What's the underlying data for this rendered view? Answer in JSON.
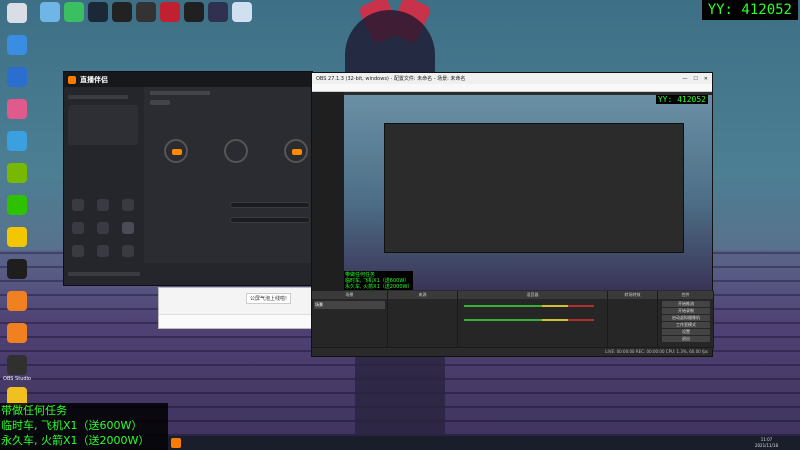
{
  "counter": "YY: 412052",
  "overlay_lines": [
    "带做任何任务",
    "临时车, 飞机X1（送600W）",
    "永久车, 火箭X1（送2000W）"
  ],
  "desktop_left": [
    {
      "label": "",
      "icon": "computer-icon",
      "color": "#d8dde6"
    },
    {
      "label": "",
      "icon": "chat-icon",
      "color": "#3a8de0"
    },
    {
      "label": "",
      "icon": "shield-icon",
      "color": "#2a6fd0"
    },
    {
      "label": "",
      "icon": "petal-icon",
      "color": "#e05a8c"
    },
    {
      "label": "",
      "icon": "cloud-icon",
      "color": "#3aa0e0"
    },
    {
      "label": "",
      "icon": "nvidia-icon",
      "color": "#76b900"
    },
    {
      "label": "",
      "icon": "wechat-icon",
      "color": "#2dc100"
    },
    {
      "label": "",
      "icon": "qq-game-icon",
      "color": "#f2c600"
    },
    {
      "label": "",
      "icon": "qq-icon",
      "color": "#1e1e1e"
    },
    {
      "label": "",
      "icon": "tool-icon",
      "color": "#f08020"
    },
    {
      "label": "",
      "icon": "tool2-icon",
      "color": "#f08020"
    },
    {
      "label": "OBS Studio",
      "icon": "obs-icon",
      "color": "#303030"
    },
    {
      "label": "",
      "icon": "misc-icon",
      "color": "#f0c020"
    }
  ],
  "desktop_top": [
    {
      "label": "",
      "icon": "recycle-icon",
      "color": "#6fb6e6"
    },
    {
      "label": "",
      "icon": "app-icon",
      "color": "#3ac060"
    },
    {
      "label": "",
      "icon": "steam-icon",
      "color": "#1b2838"
    },
    {
      "label": "",
      "icon": "game-icon",
      "color": "#222"
    },
    {
      "label": "",
      "icon": "game2-icon",
      "color": "#333"
    },
    {
      "label": "",
      "icon": "game3-icon",
      "color": "#c02030"
    },
    {
      "label": "",
      "icon": "game4-icon",
      "color": "#202020"
    },
    {
      "label": "",
      "icon": "game5-icon",
      "color": "#303050"
    },
    {
      "label": "",
      "icon": "game6-icon",
      "color": "#d0e0f0"
    }
  ],
  "app": {
    "title": "直播伴侣"
  },
  "popup": {
    "bubble": "公屏气泡上线啦!"
  },
  "obs": {
    "title": "OBS 27.1.3 (32-bit, windows) - 配置文件: 未命名 - 场景: 未命名",
    "overlay_lines": [
      "带做任何任务",
      "临时车, 飞机X1（送600W）",
      "永久车, 火箭X1（送2000W）"
    ],
    "counter": "YY: 412052",
    "docks": [
      "场景",
      "来源",
      "混音器",
      "转场特效",
      "控件"
    ],
    "scene_item": "场景",
    "controls": [
      "开始推流",
      "开始录制",
      "启动虚拟摄像机",
      "工作室模式",
      "设置",
      "退出"
    ],
    "status": "LIVE: 00:00:00   REC: 00:00:00   CPU: 1.3%, 60.00 fps"
  },
  "clock": {
    "time": "11:07",
    "date": "2021/11/18"
  }
}
